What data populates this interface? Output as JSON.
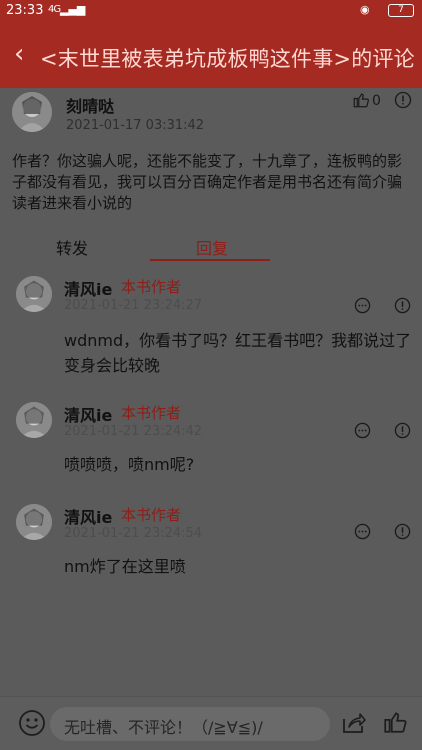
{
  "status_bar": {
    "time": "23:33",
    "indicators": "4G",
    "battery": "7"
  },
  "header": {
    "title": "<末世里被表弟坑成板鸭这件事>的评论"
  },
  "comment": {
    "username": "刻晴哒",
    "datetime": "2021-01-17 03:31:42",
    "like_count": "0",
    "body": "作者？你这骗人呢，还能不能变了，十九章了，连板鸭的影子都没有看见，我可以百分百确定作者是用书名还有简介骗读者进来看小说的"
  },
  "tabs": [
    {
      "label": "转发"
    },
    {
      "label": "回复"
    }
  ],
  "replies": [
    {
      "username": "清风ie",
      "tag": "本书作者",
      "datetime": "2021-01-21 23:24:27",
      "text": "wdnmd，你看书了吗？红王看书吧？我都说过了变身会比较晚"
    },
    {
      "username": "清风ie",
      "tag": "本书作者",
      "datetime": "2021-01-21 23:24:42",
      "text": "喷喷喷，喷nm呢?"
    },
    {
      "username": "清风ie",
      "tag": "本书作者",
      "datetime": "2021-01-21 23:24:54",
      "text": "nm炸了在这里喷"
    }
  ],
  "bottom_bar": {
    "input_placeholder": "无吐槽、不评论！（/≧∀≦)/"
  },
  "colors": {
    "header": "#a52a21",
    "accent": "#8e1f18",
    "overlay_bg": "#5b5b5b"
  }
}
